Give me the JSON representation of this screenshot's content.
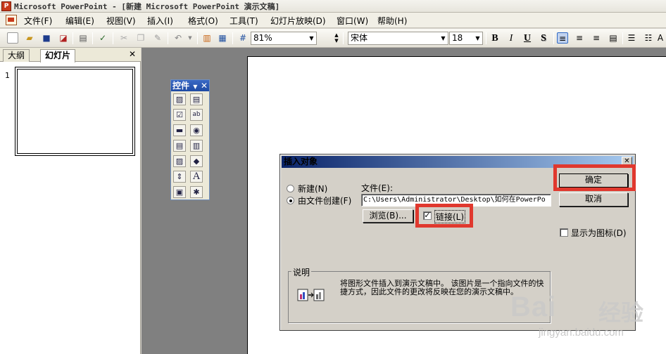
{
  "title": "Microsoft PowerPoint - [新建 Microsoft PowerPoint 演示文稿]",
  "menu": [
    "文件(F)",
    "编辑(E)",
    "视图(V)",
    "插入(I)",
    "格式(O)",
    "工具(T)",
    "幻灯片放映(D)",
    "窗口(W)",
    "帮助(H)"
  ],
  "toolbar": {
    "zoom": "81%",
    "font": "宋体",
    "size": "18",
    "bold": "B",
    "italic": "I",
    "underline": "U",
    "shadow": "S"
  },
  "tabs": {
    "outline": "大纲",
    "slides": "幻灯片"
  },
  "slide_number": "1",
  "toolbox": {
    "title": "控件"
  },
  "dialog": {
    "title": "插入对象",
    "radio_new": "新建(N)",
    "radio_from_file": "由文件创建(F)",
    "file_label": "文件(E):",
    "file_path": "C:\\Users\\Administrator\\Desktop\\如何在PowerPo",
    "browse": "浏览(B)...",
    "link": "链接(L)",
    "ok": "确定",
    "cancel": "取消",
    "show_as_icon": "显示为图标(D)",
    "description_label": "说明",
    "description": "将图形文件插入到演示文稿中。 该图片是一个指向文件的快捷方式，因此文件的更改将反映在您的演示文稿中。"
  },
  "watermark": {
    "brand": "Bai",
    "brand2": "经验",
    "url": "jingyan.baidu.com"
  },
  "colors": {
    "highlight": "#e0382e",
    "dialog_title": "#0a246a",
    "workspace": "#808080"
  }
}
